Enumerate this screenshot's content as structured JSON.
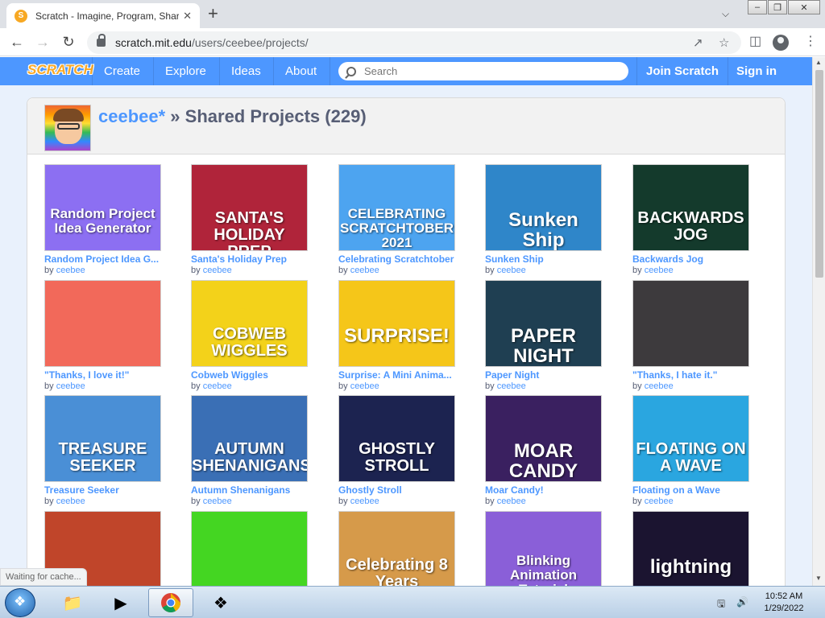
{
  "browser": {
    "tab_title": "Scratch - Imagine, Program, Share",
    "tab_close": "✕",
    "new_tab": "+",
    "tab_menu": "⌄",
    "url_host": "scratch.mit.edu",
    "url_path": "/users/ceebee/projects/"
  },
  "scratch_nav": {
    "logo": "SCRATCH",
    "links": [
      "Create",
      "Explore",
      "Ideas",
      "About"
    ],
    "search_placeholder": "Search",
    "join": "Join Scratch",
    "sign_in": "Sign in"
  },
  "header": {
    "username": "ceebee*",
    "separator": " » ",
    "title": "Shared Projects (229)"
  },
  "projects": [
    {
      "title": "Random Project Idea G...",
      "thumb_text": "Random Project Idea Generator",
      "author": "ceebee",
      "bg": "#8c6ff2"
    },
    {
      "title": "Santa's Holiday Prep",
      "thumb_text": "SANTA'S HOLIDAY PREP",
      "author": "ceebee",
      "bg": "#b0243a"
    },
    {
      "title": "Celebrating Scratchtober",
      "thumb_text": "CELEBRATING SCRATCHTOBER 2021",
      "author": "ceebee",
      "bg": "#4da4f0"
    },
    {
      "title": "Sunken Ship",
      "thumb_text": "Sunken Ship",
      "author": "ceebee",
      "bg": "#2f86c9"
    },
    {
      "title": "Backwards Jog",
      "thumb_text": "BACKWARDS JOG",
      "author": "ceebee",
      "bg": "#143a2c"
    },
    {
      "title": "\"Thanks, I love it!\"",
      "thumb_text": "",
      "author": "ceebee",
      "bg": "#f2695a"
    },
    {
      "title": "Cobweb Wiggles",
      "thumb_text": "COBWEB WIGGLES",
      "author": "ceebee",
      "bg": "#f3d21a"
    },
    {
      "title": "Surprise: A Mini Anima...",
      "thumb_text": "SURPRISE!",
      "author": "ceebee",
      "bg": "#f5c619"
    },
    {
      "title": "Paper Night",
      "thumb_text": "PAPER NIGHT",
      "author": "ceebee",
      "bg": "#1f3f52"
    },
    {
      "title": "\"Thanks, I hate it.\"",
      "thumb_text": "",
      "author": "ceebee",
      "bg": "#3d3a3d"
    },
    {
      "title": "Treasure Seeker",
      "thumb_text": "TREASURE SEEKER",
      "author": "ceebee",
      "bg": "#4a8fd6"
    },
    {
      "title": "Autumn Shenanigans",
      "thumb_text": "AUTUMN SHENANIGANS",
      "author": "ceebee",
      "bg": "#3a6fb5"
    },
    {
      "title": "Ghostly Stroll",
      "thumb_text": "GHOSTLY STROLL",
      "author": "ceebee",
      "bg": "#1c2350"
    },
    {
      "title": "Moar Candy!",
      "thumb_text": "MOAR CANDY",
      "author": "ceebee",
      "bg": "#3a2060"
    },
    {
      "title": "Floating on a Wave",
      "thumb_text": "FLOATING ON A WAVE",
      "author": "ceebee",
      "bg": "#2aa6e0"
    },
    {
      "title": "",
      "thumb_text": "",
      "author": "",
      "bg": "#c0452a"
    },
    {
      "title": "",
      "thumb_text": "",
      "author": "",
      "bg": "#44d622"
    },
    {
      "title": "",
      "thumb_text": "Celebrating 8 Years",
      "author": "",
      "bg": "#d69a4a"
    },
    {
      "title": "",
      "thumb_text": "Blinking Animation Tutorial",
      "author": "",
      "bg": "#8a5fd8"
    },
    {
      "title": "",
      "thumb_text": "lightning",
      "author": "",
      "bg": "#1b1430"
    }
  ],
  "by_label": "by",
  "status_text": "Waiting for cache...",
  "clock": {
    "time": "10:52 AM",
    "date": "1/29/2022"
  }
}
